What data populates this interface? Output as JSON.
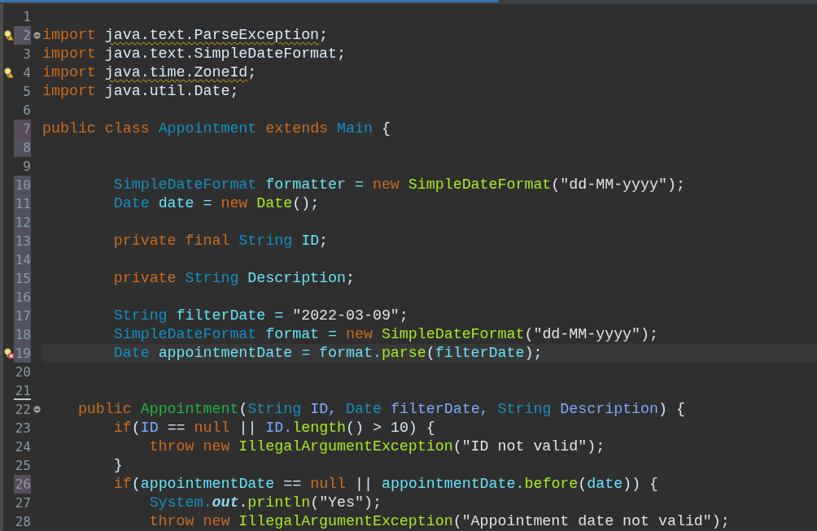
{
  "editor": {
    "lines": [
      {
        "number": "1"
      },
      {
        "number": "2",
        "warning_marker": true,
        "fold": true,
        "color": "#585262",
        "tokens": [
          {
            "text": "import ",
            "kind": "kw"
          },
          {
            "text": "java.text.ParseException",
            "kind": "plain",
            "warning": true
          },
          {
            "text": ";",
            "kind": "plain"
          }
        ]
      },
      {
        "number": "3",
        "tokens": [
          {
            "text": "import ",
            "kind": "kw"
          },
          {
            "text": "java.text.SimpleDateFormat;",
            "kind": "plain"
          }
        ]
      },
      {
        "number": "4",
        "warning_marker": true,
        "tokens": [
          {
            "text": "import ",
            "kind": "kw"
          },
          {
            "text": "java.time.ZoneId",
            "kind": "plain",
            "warning": true
          },
          {
            "text": ";",
            "kind": "plain"
          }
        ]
      },
      {
        "number": "5",
        "tokens": [
          {
            "text": "import ",
            "kind": "kw"
          },
          {
            "text": "java.util.Date;",
            "kind": "plain"
          }
        ]
      },
      {
        "number": "6"
      },
      {
        "number": "7",
        "color": "#5a4b5a",
        "tokens": [
          {
            "text": "public class ",
            "kind": "kw"
          },
          {
            "text": "Appointment ",
            "kind": "type"
          },
          {
            "text": "extends ",
            "kind": "kw"
          },
          {
            "text": "Main ",
            "kind": "type"
          },
          {
            "text": "{",
            "kind": "plain"
          }
        ]
      },
      {
        "number": "8",
        "color": "#52525e"
      },
      {
        "number": "9"
      },
      {
        "number": "10",
        "color": "#50535f",
        "tokens": [
          {
            "text": "        SimpleDateFormat ",
            "kind": "type"
          },
          {
            "text": "formatter = ",
            "kind": "field"
          },
          {
            "text": "new ",
            "kind": "kw"
          },
          {
            "text": "SimpleDateFormat",
            "kind": "call"
          },
          {
            "text": "(\"dd-MM-yyyy\");",
            "kind": "str"
          }
        ]
      },
      {
        "number": "11",
        "color": "#50535f",
        "tokens": [
          {
            "text": "        Date ",
            "kind": "type"
          },
          {
            "text": "date = ",
            "kind": "field"
          },
          {
            "text": "new ",
            "kind": "kw"
          },
          {
            "text": "Date",
            "kind": "call"
          },
          {
            "text": "();",
            "kind": "plain"
          }
        ]
      },
      {
        "number": "12",
        "color": "#50535f"
      },
      {
        "number": "13",
        "color": "#50535f",
        "tokens": [
          {
            "text": "        private final ",
            "kind": "kw"
          },
          {
            "text": "String ",
            "kind": "type"
          },
          {
            "text": "ID",
            "kind": "field"
          },
          {
            "text": ";",
            "kind": "plain"
          }
        ]
      },
      {
        "number": "14",
        "color": "#50535f"
      },
      {
        "number": "15",
        "color": "#50535f",
        "tokens": [
          {
            "text": "        private ",
            "kind": "kw"
          },
          {
            "text": "String ",
            "kind": "type"
          },
          {
            "text": "Description",
            "kind": "field"
          },
          {
            "text": ";",
            "kind": "plain"
          }
        ]
      },
      {
        "number": "16",
        "color": "#50535f"
      },
      {
        "number": "17",
        "color": "#50535f",
        "tokens": [
          {
            "text": "        String ",
            "kind": "type"
          },
          {
            "text": "filterDate = ",
            "kind": "field"
          },
          {
            "text": "\"2022-03-09\";",
            "kind": "str"
          }
        ]
      },
      {
        "number": "18",
        "color": "#50535f",
        "tokens": [
          {
            "text": "        SimpleDateFormat ",
            "kind": "type"
          },
          {
            "text": "format = ",
            "kind": "field"
          },
          {
            "text": "new ",
            "kind": "kw"
          },
          {
            "text": "SimpleDateFormat",
            "kind": "call"
          },
          {
            "text": "(\"dd-MM-yyyy\");",
            "kind": "str"
          }
        ]
      },
      {
        "number": "19",
        "color": "#50535f",
        "error_marker": true,
        "current": true,
        "tokens": [
          {
            "text": "        Date ",
            "kind": "type"
          },
          {
            "text": "appointmentDate = format.",
            "kind": "field"
          },
          {
            "text": "parse",
            "kind": "call"
          },
          {
            "text": "(",
            "kind": "plain"
          },
          {
            "text": "filterDate",
            "kind": "field"
          },
          {
            "text": ");",
            "kind": "plain"
          }
        ]
      },
      {
        "number": "20"
      },
      {
        "number": "21",
        "underlined": true
      },
      {
        "number": "22",
        "fold": true,
        "tokens": [
          {
            "text": "    public ",
            "kind": "kw"
          },
          {
            "text": "Appointment",
            "kind": "ctor"
          },
          {
            "text": "(",
            "kind": "plain"
          },
          {
            "text": "String ",
            "kind": "type"
          },
          {
            "text": "ID, ",
            "kind": "param"
          },
          {
            "text": "Date ",
            "kind": "type"
          },
          {
            "text": "filterDate, ",
            "kind": "param"
          },
          {
            "text": "String ",
            "kind": "type"
          },
          {
            "text": "Description",
            "kind": "param"
          },
          {
            "text": ") {",
            "kind": "plain"
          }
        ]
      },
      {
        "number": "23",
        "tokens": [
          {
            "text": "        if",
            "kind": "kw"
          },
          {
            "text": "(",
            "kind": "plain"
          },
          {
            "text": "ID",
            "kind": "param"
          },
          {
            "text": " == ",
            "kind": "plain"
          },
          {
            "text": "null",
            "kind": "kw"
          },
          {
            "text": " || ",
            "kind": "plain"
          },
          {
            "text": "ID.",
            "kind": "param"
          },
          {
            "text": "length",
            "kind": "call"
          },
          {
            "text": "() > 10) {",
            "kind": "plain"
          }
        ]
      },
      {
        "number": "24",
        "tokens": [
          {
            "text": "            throw new ",
            "kind": "kw"
          },
          {
            "text": "IllegalArgumentException",
            "kind": "call"
          },
          {
            "text": "(\"ID not valid\");",
            "kind": "str"
          }
        ]
      },
      {
        "number": "25",
        "tokens": [
          {
            "text": "        }",
            "kind": "plain"
          }
        ]
      },
      {
        "number": "26",
        "color": "#5a4b5a",
        "tokens": [
          {
            "text": "        if",
            "kind": "kw"
          },
          {
            "text": "(",
            "kind": "plain"
          },
          {
            "text": "appointmentDate",
            "kind": "field"
          },
          {
            "text": " == ",
            "kind": "plain"
          },
          {
            "text": "null",
            "kind": "kw"
          },
          {
            "text": " || ",
            "kind": "plain"
          },
          {
            "text": "appointmentDate.",
            "kind": "field"
          },
          {
            "text": "before",
            "kind": "call"
          },
          {
            "text": "(",
            "kind": "plain"
          },
          {
            "text": "date",
            "kind": "field"
          },
          {
            "text": ")) {",
            "kind": "plain"
          }
        ]
      },
      {
        "number": "27",
        "tokens": [
          {
            "text": "            System.",
            "kind": "type"
          },
          {
            "text": "out",
            "kind": "static"
          },
          {
            "text": ".",
            "kind": "plain"
          },
          {
            "text": "println",
            "kind": "call"
          },
          {
            "text": "(\"Yes\");",
            "kind": "str"
          }
        ]
      },
      {
        "number": "28",
        "tokens": [
          {
            "text": "            throw new ",
            "kind": "kw"
          },
          {
            "text": "IllegalArgumentException",
            "kind": "call"
          },
          {
            "text": "(\"Appointment date not valid\");",
            "kind": "str"
          }
        ]
      }
    ]
  }
}
